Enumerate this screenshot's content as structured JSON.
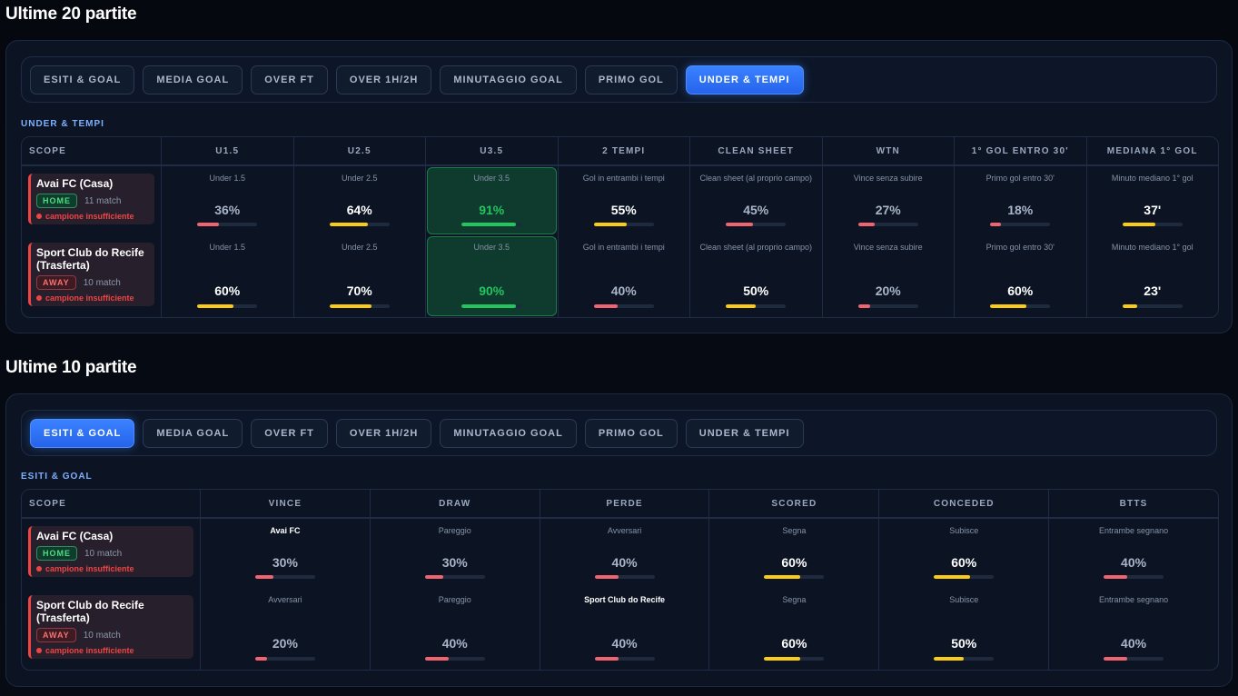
{
  "section1": {
    "title": "Ultime 20 partite",
    "tabs": [
      "ESITI & GOAL",
      "MEDIA GOAL",
      "OVER FT",
      "OVER 1H/2H",
      "MINUTAGGIO GOAL",
      "PRIMO GOL",
      "UNDER & TEMPI"
    ],
    "active_tab": 6,
    "sub_label": "UNDER & TEMPI",
    "scope_header": "SCOPE",
    "columns": [
      "U1.5",
      "U2.5",
      "U3.5",
      "2 TEMPI",
      "CLEAN SHEET",
      "WTN",
      "1° GOL ENTRO 30'",
      "MEDIANA 1° GOL"
    ],
    "cell_labels": [
      "Under 1.5",
      "Under 2.5",
      "Under 3.5",
      "Gol in entrambi i tempi",
      "Clean sheet (al proprio campo)",
      "Vince senza subire",
      "Primo gol entro 30'",
      "Minuto mediano 1° gol"
    ],
    "rows": [
      {
        "team": "Avai FC (Casa)",
        "badge": "HOME",
        "matches": "11 match",
        "warning": "campione insufficiente",
        "values": [
          "36%",
          "64%",
          "91%",
          "55%",
          "45%",
          "27%",
          "18%",
          "37'"
        ],
        "levels": [
          36,
          64,
          91,
          55,
          45,
          27,
          18,
          55
        ],
        "colors": [
          "red",
          "yellow",
          "green",
          "yellow",
          "red",
          "red",
          "red",
          "yellow"
        ]
      },
      {
        "team": "Sport Club do Recife (Trasferta)",
        "badge": "AWAY",
        "matches": "10 match",
        "warning": "campione insufficiente",
        "values": [
          "60%",
          "70%",
          "90%",
          "40%",
          "50%",
          "20%",
          "60%",
          "23'"
        ],
        "levels": [
          60,
          70,
          90,
          40,
          50,
          20,
          60,
          25
        ],
        "colors": [
          "yellow",
          "yellow",
          "green",
          "red",
          "yellow",
          "red",
          "yellow",
          "yellow"
        ]
      }
    ]
  },
  "section2": {
    "title": "Ultime 10 partite",
    "tabs": [
      "ESITI & GOAL",
      "MEDIA GOAL",
      "OVER FT",
      "OVER 1H/2H",
      "MINUTAGGIO GOAL",
      "PRIMO GOL",
      "UNDER & TEMPI"
    ],
    "active_tab": 0,
    "sub_label": "ESITI & GOAL",
    "scope_header": "SCOPE",
    "columns": [
      "VINCE",
      "DRAW",
      "PERDE",
      "SCORED",
      "CONCEDED",
      "BTTS"
    ],
    "rows": [
      {
        "team": "Avai FC (Casa)",
        "badge": "HOME",
        "matches": "10 match",
        "warning": "campione insufficiente",
        "labels": [
          "Avai FC",
          "Pareggio",
          "Avversari",
          "Segna",
          "Subisce",
          "Entrambe segnano"
        ],
        "strong": [
          true,
          false,
          false,
          false,
          false,
          false
        ],
        "values": [
          "30%",
          "30%",
          "40%",
          "60%",
          "60%",
          "40%"
        ],
        "levels": [
          30,
          30,
          40,
          60,
          60,
          40
        ],
        "colors": [
          "red",
          "red",
          "red",
          "yellow",
          "yellow",
          "red"
        ]
      },
      {
        "team": "Sport Club do Recife (Trasferta)",
        "badge": "AWAY",
        "matches": "10 match",
        "warning": "campione insufficiente",
        "labels": [
          "Avversari",
          "Pareggio",
          "Sport Club do Recife",
          "Segna",
          "Subisce",
          "Entrambe segnano"
        ],
        "strong": [
          false,
          false,
          true,
          false,
          false,
          false
        ],
        "values": [
          "20%",
          "40%",
          "40%",
          "60%",
          "50%",
          "40%"
        ],
        "levels": [
          20,
          40,
          40,
          60,
          50,
          40
        ],
        "colors": [
          "red",
          "red",
          "red",
          "yellow",
          "yellow",
          "red"
        ]
      }
    ]
  }
}
